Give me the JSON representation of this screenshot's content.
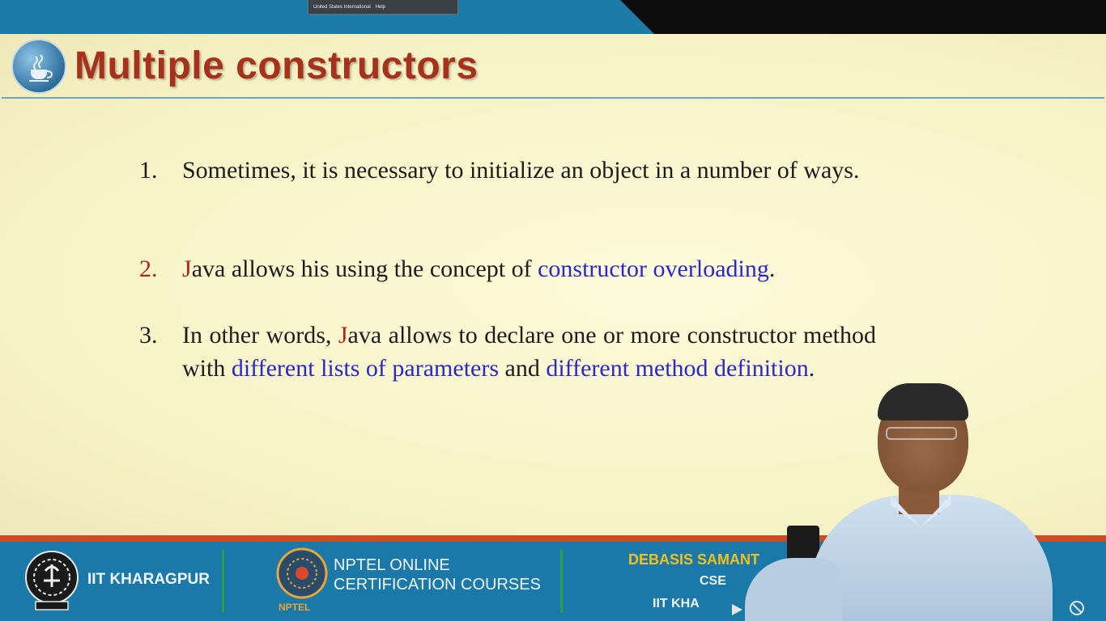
{
  "topbar": {
    "language_label": "United States International",
    "help_label": "Help"
  },
  "slide": {
    "title": "Multiple constructors",
    "logo_icon": "java-cup-icon",
    "items": [
      {
        "number": "1.",
        "text": "Sometimes, it is necessary to initialize an object in a number of ways."
      },
      {
        "number": "2.",
        "first_letter": "J",
        "text_before": "ava allows his using the concept of ",
        "highlight": "constructor overloading",
        "text_after": "."
      },
      {
        "number": "3.",
        "text_before": "In other words, ",
        "first_letter": "J",
        "text_middle": "ava allows to declare one or more constructor method with ",
        "highlight1": "different lists of parameters",
        "text_and": " and ",
        "highlight2": "different method definition",
        "text_after": "."
      }
    ]
  },
  "footer": {
    "institute": "IIT KHARAGPUR",
    "nptel_line1": "NPTEL ONLINE",
    "nptel_line2": "CERTIFICATION COURSES",
    "nptel_logo_label": "NPTEL",
    "presenter_name": "DEBASIS SAMANT",
    "presenter_dept": "CSE",
    "presenter_inst": "IIT KHA"
  },
  "colors": {
    "title": "#a7321b",
    "highlight_blue": "#2b28c9",
    "highlight_red": "#b0261c",
    "footer_bg": "#1a79a8",
    "footer_stripe": "#c94d24",
    "presenter_name": "#f2c21b",
    "slide_bg": "#f7f2c6"
  }
}
